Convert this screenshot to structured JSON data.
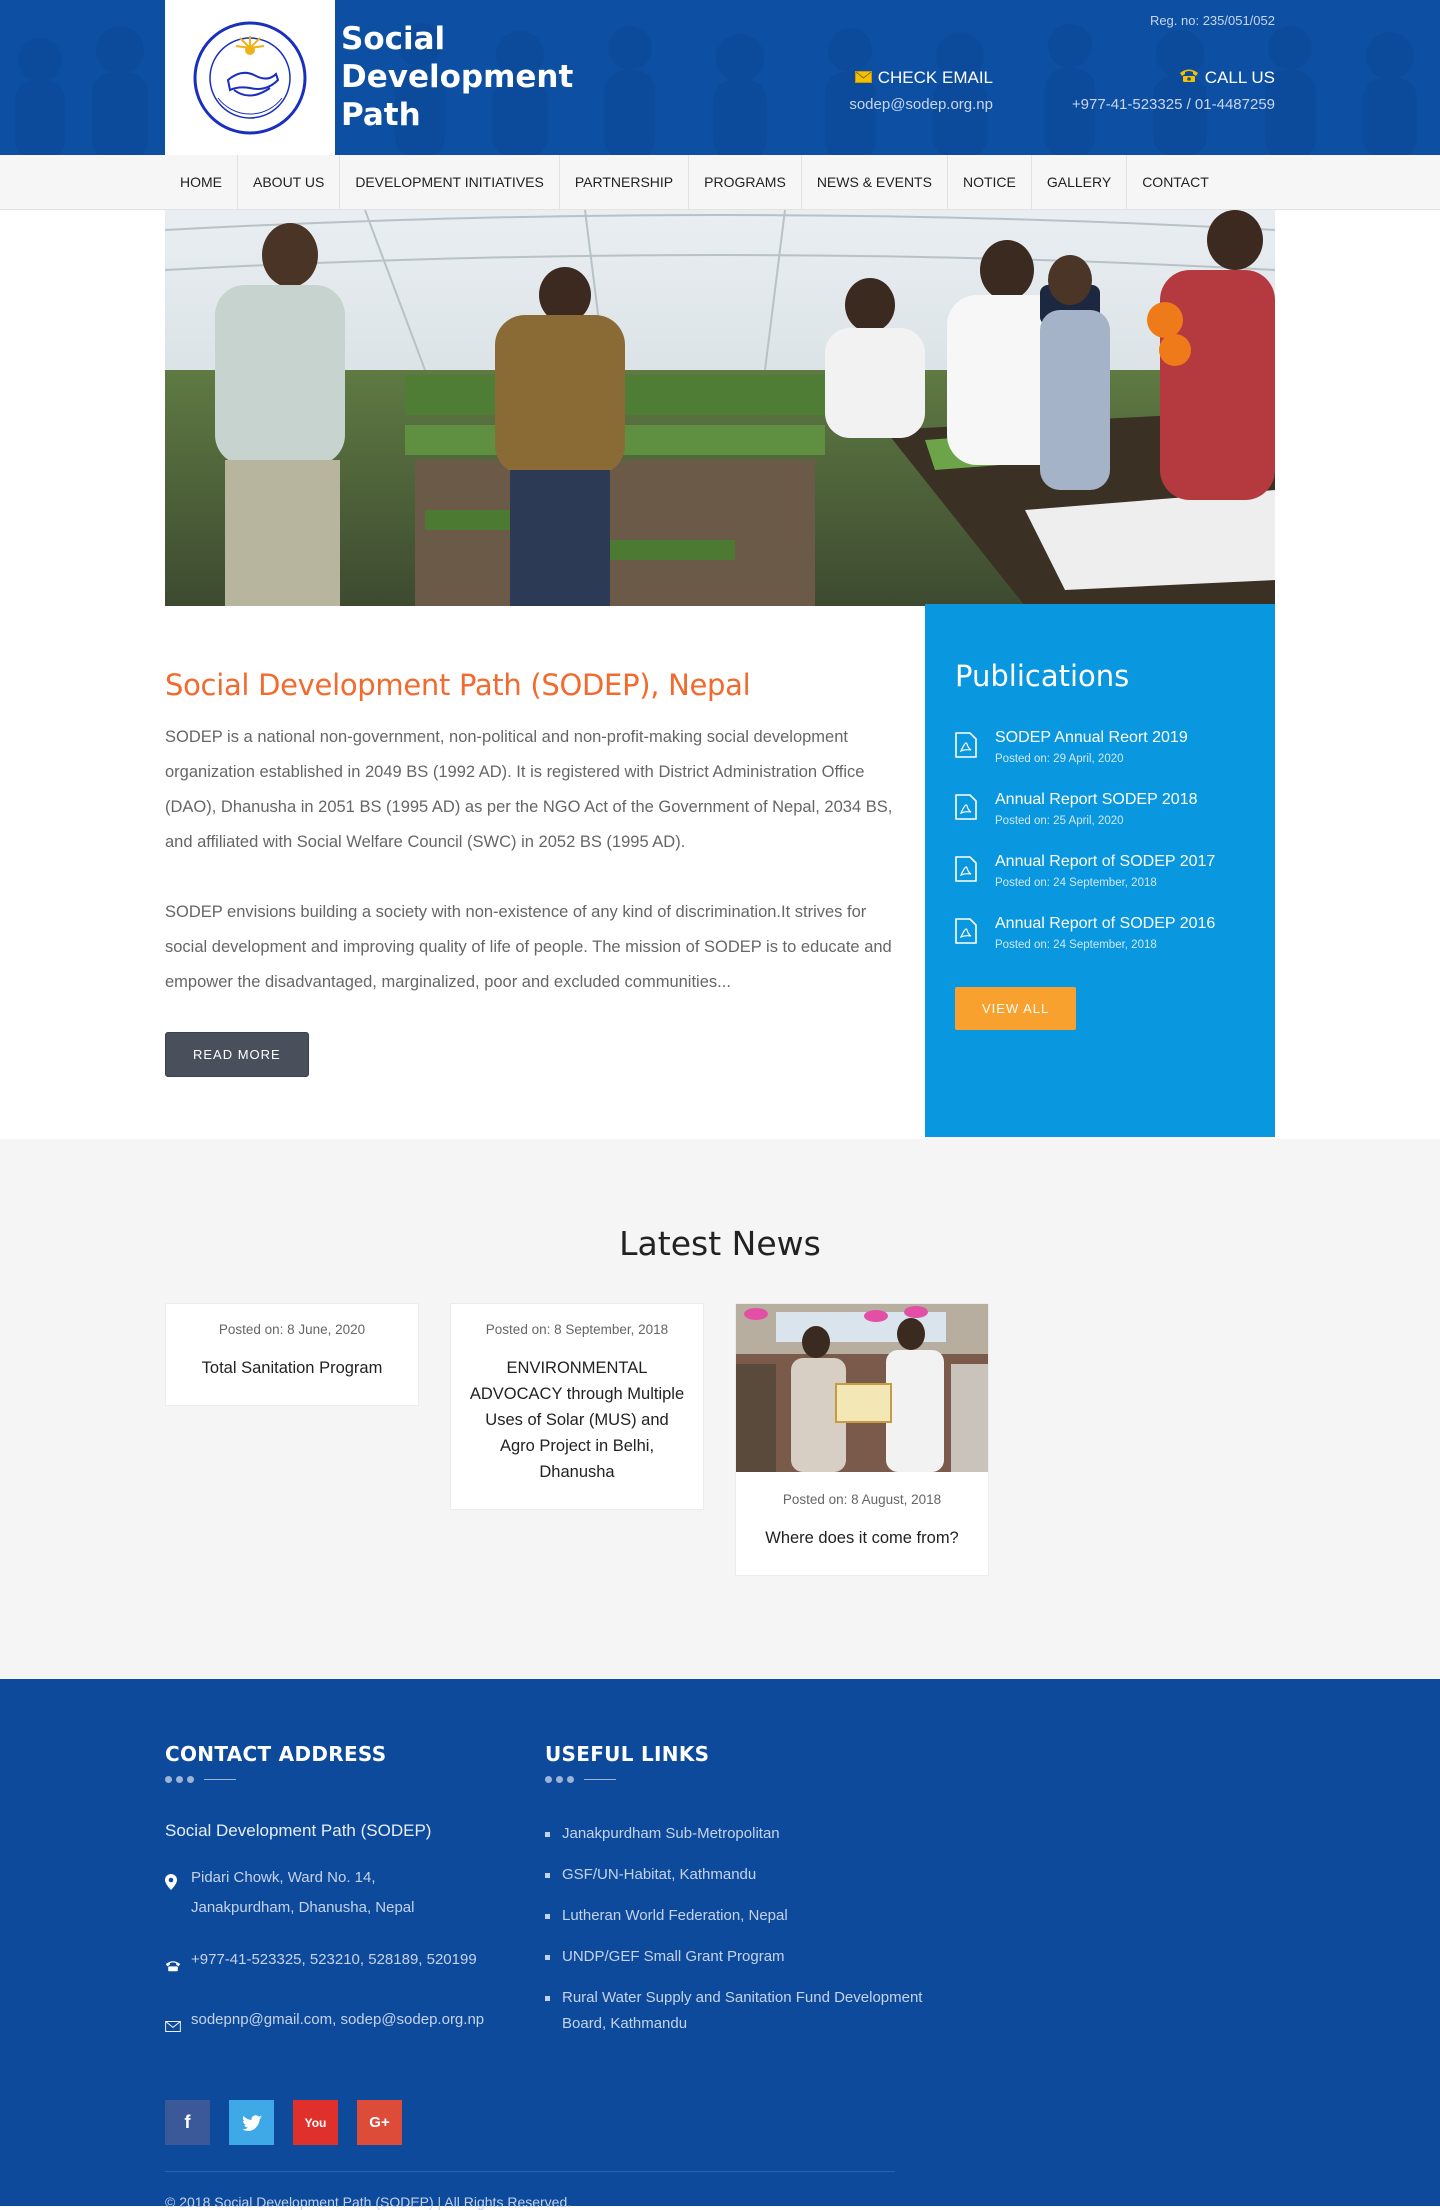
{
  "header": {
    "site_title_line1": "Social",
    "site_title_line2": "Development",
    "site_title_line3": "Path",
    "logo_ring_text": "SOCIAL DEVELOPMENT PATH (SODEP)",
    "logo_estd": "Estd. 2049",
    "reg_no": "Reg. no: 235/051/052",
    "email_label": "CHECK EMAIL",
    "email_value": "sodep@sodep.org.np",
    "call_label": "CALL US",
    "call_value": "+977-41-523325 / 01-4487259"
  },
  "nav": {
    "items": [
      "HOME",
      "ABOUT US",
      "DEVELOPMENT INITIATIVES",
      "PARTNERSHIP",
      "PROGRAMS",
      "NEWS & EVENTS",
      "NOTICE",
      "GALLERY",
      "CONTACT"
    ]
  },
  "about": {
    "title": "Social Development Path (SODEP), Nepal",
    "para1": "SODEP is a national non-government, non-political and non-profit-making social development organization established in 2049 BS (1992 AD). It is registered with District Administration Office (DAO), Dhanusha in 2051 BS (1995 AD) as per the NGO Act of the Government of Nepal, 2034 BS, and affiliated with Social Welfare Council (SWC) in 2052 BS (1995 AD).",
    "para2": "SODEP envisions building a society with non-existence of any kind of discrimination.It strives for social development and improving quality of life of people. The mission of SODEP is to educate and empower the disadvantaged, marginalized, poor and excluded communities...",
    "read_more": "READ MORE"
  },
  "publications": {
    "title": "Publications",
    "items": [
      {
        "title": "SODEP Annual Reort 2019",
        "date": "Posted on: 29 April, 2020"
      },
      {
        "title": "Annual Report SODEP 2018",
        "date": "Posted on: 25 April, 2020"
      },
      {
        "title": "Annual Report of SODEP 2017",
        "date": "Posted on: 24 September, 2018"
      },
      {
        "title": "Annual Report of SODEP 2016",
        "date": "Posted on: 24 September, 2018"
      }
    ],
    "view_all": "VIEW ALL"
  },
  "news": {
    "title": "Latest News",
    "items": [
      {
        "date": "Posted on: 8 June, 2020",
        "title": "Total Sanitation Program"
      },
      {
        "date": "Posted on: 8 September, 2018",
        "title": "ENVIRONMENTAL ADVOCACY through Multiple Uses of Solar (MUS) and Agro Project in Belhi, Dhanusha"
      },
      {
        "date": "Posted on: 8 August, 2018",
        "title": "Where does it come from?"
      }
    ]
  },
  "footer": {
    "contact_title": "CONTACT ADDRESS",
    "org_name": "Social Development Path (SODEP)",
    "address_line1": "Pidari Chowk, Ward No. 14,",
    "address_line2": "Janakpurdham, Dhanusha, Nepal",
    "phones": "+977-41-523325, 523210, 528189, 520199",
    "emails": "sodepnp@gmail.com, sodep@sodep.org.np",
    "links_title": "USEFUL LINKS",
    "links": [
      "Janakpurdham Sub-Metropolitan",
      "GSF/UN-Habitat, Kathmandu",
      "Lutheran World Federation, Nepal",
      "UNDP/GEF Small Grant Program",
      "Rural Water Supply and Sanitation Fund Development Board, Kathmandu"
    ],
    "social": {
      "facebook": "f",
      "youtube": "You",
      "googleplus": "G+"
    },
    "copyright": "© 2018 Social Development Path (SODEP) | All Rights Reserved."
  },
  "colors": {
    "header_blue": "#0d4fa3",
    "publications_blue": "#0997e0",
    "accent_orange": "#f26a2e",
    "button_orange": "#f9a12f",
    "footer_blue": "#0d4a9c"
  }
}
